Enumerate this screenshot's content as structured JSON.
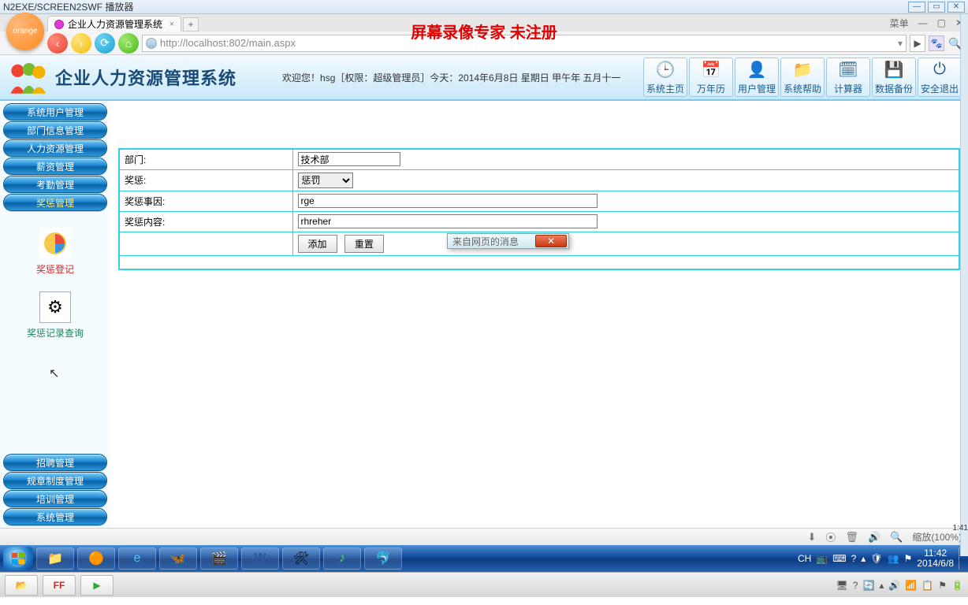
{
  "player": {
    "title": "N2EXE/SCREEN2SWF 播放器"
  },
  "browser": {
    "tab_label": "企业人力资源管理系统",
    "url": "http://localhost:802/main.aspx",
    "url_display_prefix": "http://",
    "menu_label": "菜单",
    "watermark": "屏幕录像专家 未注册",
    "zoom": "缩放(100%)"
  },
  "header": {
    "title": "企业人力资源管理系统",
    "welcome": "欢迎您！hsg［权限：超级管理员］今天：2014年6月8日 星期日 甲午年 五月十一",
    "buttons": [
      {
        "id": "home",
        "label": "系统主页",
        "icon": "🕒"
      },
      {
        "id": "calendar",
        "label": "万年历",
        "icon": "📅"
      },
      {
        "id": "users",
        "label": "用户管理",
        "icon": "👤"
      },
      {
        "id": "help",
        "label": "系统帮助",
        "icon": "📁"
      },
      {
        "id": "calc",
        "label": "计算器",
        "icon": "🗓"
      },
      {
        "id": "backup",
        "label": "数据备份",
        "icon": "💾"
      },
      {
        "id": "exit",
        "label": "安全退出",
        "icon": "⏻"
      }
    ]
  },
  "sidebar": {
    "top": [
      "系统用户管理",
      "部门信息管理",
      "人力资源管理",
      "薪资管理",
      "考勤管理",
      "奖惩管理"
    ],
    "subs": [
      {
        "label": "奖惩登记",
        "cls": "red"
      },
      {
        "label": "奖惩记录查询",
        "cls": "blu"
      }
    ],
    "bottom": [
      "招聘管理",
      "规章制度管理",
      "培训管理",
      "系统管理"
    ]
  },
  "form": {
    "rows": {
      "dept": {
        "label": "部门:",
        "value": "技术部"
      },
      "reward": {
        "label": "奖惩:",
        "selected": "惩罚"
      },
      "reason": {
        "label": "奖惩事因:",
        "value": "rge"
      },
      "content": {
        "label": "奖惩内容:",
        "value": "rhreher"
      }
    },
    "buttons": {
      "add": "添加",
      "reset": "重置"
    }
  },
  "dialog": {
    "title": "来自网页的消息"
  },
  "win": {
    "ime": "CH",
    "time": "11:42",
    "date": "2014/6/8"
  },
  "outer": {
    "side_time": "1:41"
  }
}
